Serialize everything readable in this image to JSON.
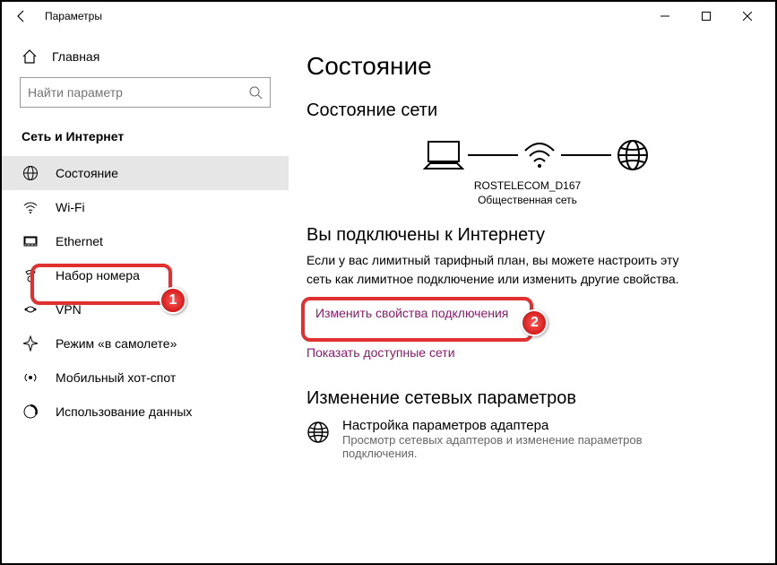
{
  "titlebar": {
    "title": "Параметры"
  },
  "sidebar": {
    "home": "Главная",
    "search_placeholder": "Найти параметр",
    "section": "Сеть и Интернет",
    "items": [
      {
        "label": "Состояние",
        "selected": true
      },
      {
        "label": "Wi-Fi"
      },
      {
        "label": "Ethernet"
      },
      {
        "label": "Набор номера"
      },
      {
        "label": "VPN"
      },
      {
        "label": "Режим «в самолете»"
      },
      {
        "label": "Мобильный хот-спот"
      },
      {
        "label": "Использование данных"
      }
    ]
  },
  "main": {
    "heading": "Состояние",
    "status_heading": "Состояние сети",
    "network_name": "ROSTELECOM_D167",
    "network_type": "Общественная сеть",
    "connected_heading": "Вы подключены к Интернету",
    "connected_text": "Если у вас лимитный тарифный план, вы можете настроить эту сеть как лимитное подключение или изменить другие свойства.",
    "link_change_props": "Изменить свойства подключения",
    "link_show_networks": "Показать доступные сети",
    "change_params_heading": "Изменение сетевых параметров",
    "adapter_title": "Настройка параметров адаптера",
    "adapter_sub": "Просмотр сетевых адаптеров и изменение параметров подключения."
  },
  "annotations": {
    "badge1": "1",
    "badge2": "2"
  }
}
